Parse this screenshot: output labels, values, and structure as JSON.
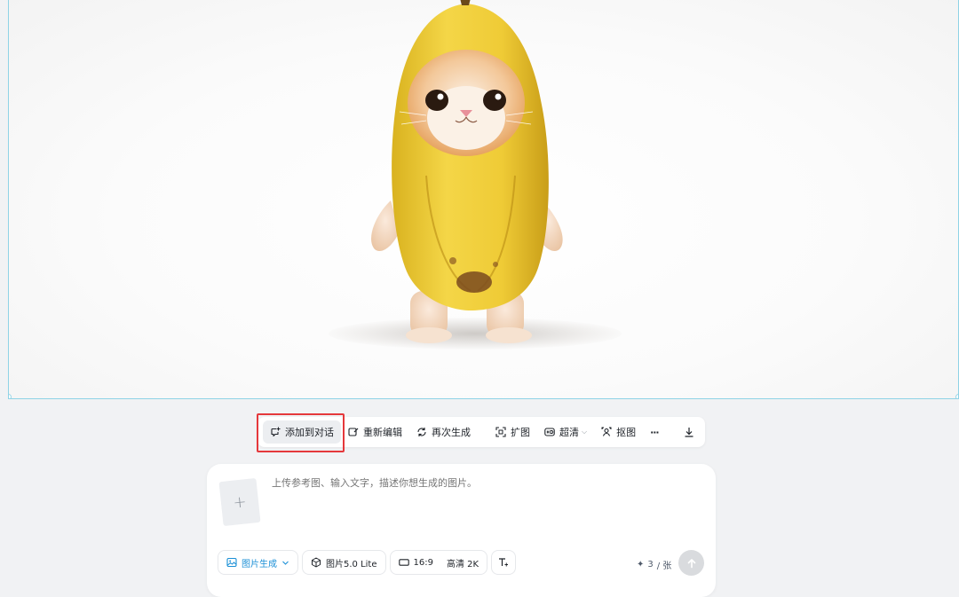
{
  "toolbar": {
    "add_to_chat": "添加到对话",
    "re_edit": "重新编辑",
    "regenerate": "再次生成",
    "expand": "扩图",
    "hd": "超清",
    "cutout": "抠图",
    "more": "···"
  },
  "composer": {
    "placeholder": "上传参考图、输入文字，描述你想生成的图片。",
    "upload_symbol": "+",
    "mode_label": "图片生成",
    "model_label": "图片5.0 Lite",
    "ratio_label": "16:9",
    "quality_label": "高清 2K",
    "credits_value": "3",
    "credits_unit": "/ 张",
    "credits_symbol": "✦"
  },
  "colors": {
    "accent": "#1a8fd6",
    "highlight_box": "#e5383b",
    "selection_border": "#8fd3e6",
    "banana_yellow": "#f0cf3c",
    "kitten_orange": "#e9a15a"
  }
}
